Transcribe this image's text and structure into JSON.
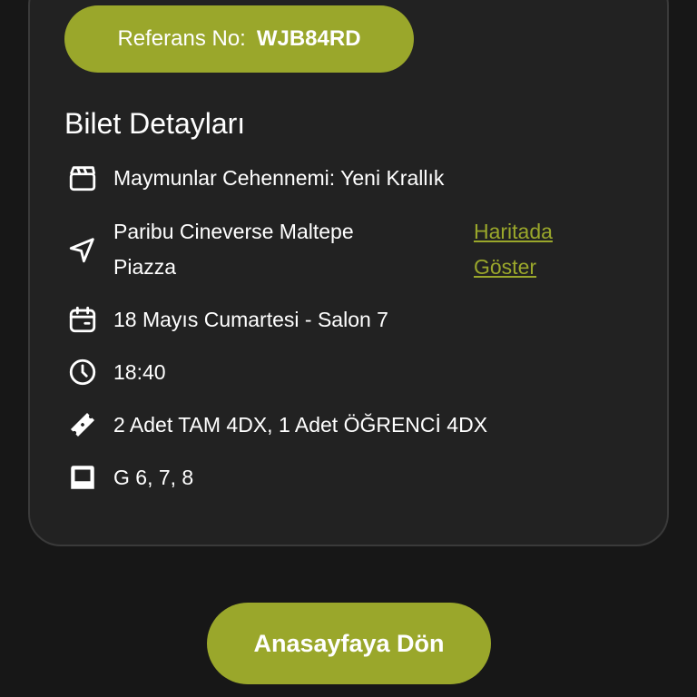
{
  "reference": {
    "label": "Referans No:",
    "code": "WJB84RD"
  },
  "details": {
    "title": "Bilet Detayları",
    "movie": "Maymunlar Cehennemi: Yeni Krallık",
    "venue": "Paribu Cineverse Maltepe Piazza",
    "map_link": "Haritada Göster",
    "date_hall": "18 Mayıs Cumartesi - Salon 7",
    "time": "18:40",
    "tickets": "2 Adet TAM 4DX, 1 Adet ÖĞRENCİ 4DX",
    "seats": "G 6, 7, 8"
  },
  "actions": {
    "home_label": "Anasayfaya Dön"
  },
  "colors": {
    "accent": "#9aa72b",
    "background": "#171717",
    "card": "#222222"
  },
  "icons": {
    "movie": "clapperboard-icon",
    "venue": "navigation-arrow-icon",
    "date": "calendar-icon",
    "time": "clock-icon",
    "tickets": "ticket-icon",
    "seats": "seat-icon"
  }
}
